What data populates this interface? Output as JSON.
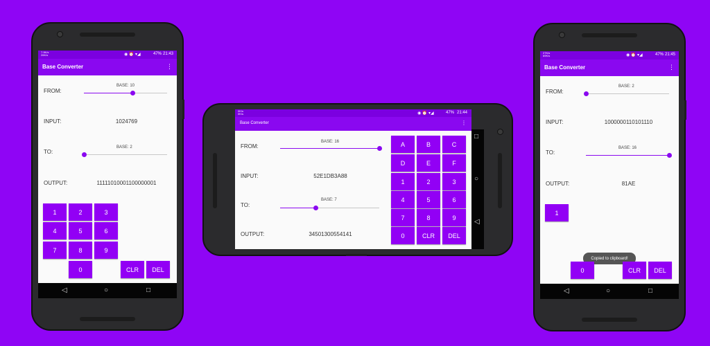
{
  "colors": {
    "background": "#8f05f5",
    "accent": "#8a08f0",
    "key": "#9200f5"
  },
  "left": {
    "status": {
      "time": "21:43",
      "battery": "47%",
      "carrier": "7.9K/s\n26K/s"
    },
    "app_title": "Base Converter",
    "menu_icon": "⋮",
    "from_label": "FROM:",
    "from_base_caption": "BASE:  10",
    "from_base_level": 0.58,
    "input_label": "INPUT:",
    "input_value": "1024769",
    "to_label": "TO:",
    "to_base_caption": "BASE:  2",
    "to_base_level": 0.0,
    "output_label": "OUTPUT:",
    "output_value": "11111010001100000001",
    "keys": [
      "1",
      "2",
      "3",
      "4",
      "5",
      "6",
      "7",
      "8",
      "9",
      "0",
      "CLR",
      "DEL"
    ],
    "nav": {
      "back": "◁",
      "home": "○",
      "recents": "□"
    }
  },
  "center": {
    "status": {
      "time": "21:44",
      "battery": "47%",
      "carrier": "0K/s\n0K/s"
    },
    "app_title": "Base Converter",
    "menu_icon": "⋮",
    "from_label": "FROM:",
    "from_base_caption": "BASE:  16",
    "from_base_level": 1.0,
    "input_label": "INPUT:",
    "input_value": "52E1DB3A88",
    "to_label": "TO:",
    "to_base_caption": "BASE:  7",
    "to_base_level": 0.36,
    "output_label": "OUTPUT:",
    "output_value": "34501300554141",
    "keys": [
      "A",
      "B",
      "C",
      "D",
      "E",
      "F",
      "1",
      "2",
      "3",
      "4",
      "5",
      "6",
      "7",
      "8",
      "9",
      "0",
      "CLR",
      "DEL"
    ],
    "nav": {
      "back": "◁",
      "home": "○",
      "recents": "□"
    }
  },
  "right": {
    "status": {
      "time": "21:45",
      "battery": "47%",
      "carrier": "27K/s\n69K/s"
    },
    "app_title": "Base Converter",
    "menu_icon": "⋮",
    "from_label": "FROM:",
    "from_base_caption": "BASE:  2",
    "from_base_level": 0.0,
    "input_label": "INPUT:",
    "input_value": "1000000110101110",
    "to_label": "TO:",
    "to_base_caption": "BASE:  16",
    "to_base_level": 1.0,
    "output_label": "OUTPUT:",
    "output_value": "81AE",
    "keys": [
      "1",
      "0",
      "CLR",
      "DEL"
    ],
    "toast": "Copied to clipboard!",
    "nav": {
      "back": "◁",
      "home": "○",
      "recents": "□"
    }
  }
}
